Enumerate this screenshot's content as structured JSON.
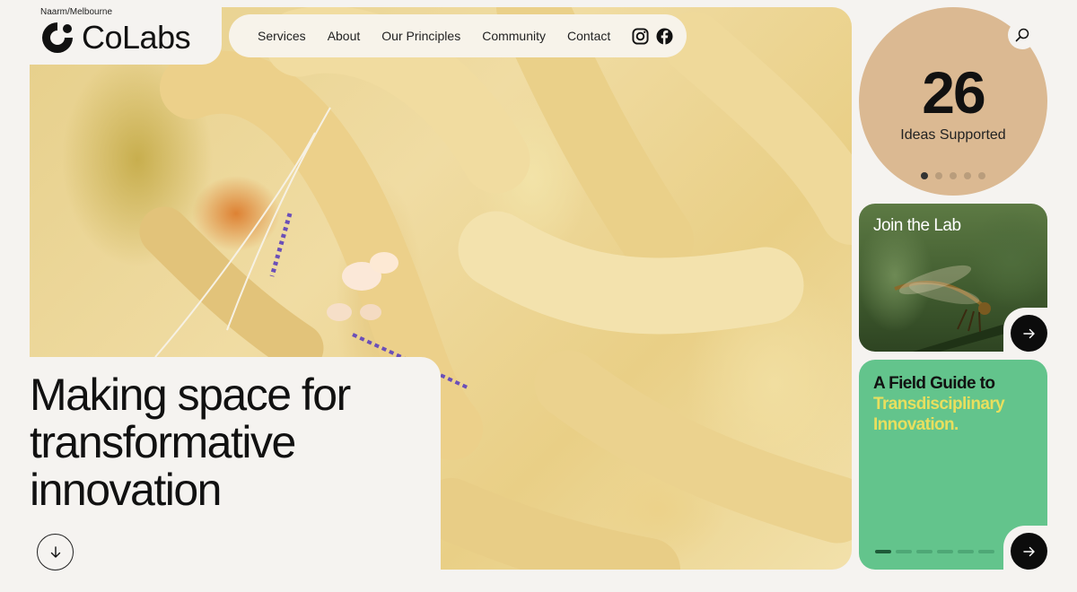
{
  "brand": {
    "region": "Naarm/Melbourne",
    "name": "CoLabs"
  },
  "nav": {
    "items": [
      "Services",
      "About",
      "Our Principles",
      "Community",
      "Contact"
    ],
    "social": [
      "instagram-icon",
      "facebook-icon"
    ]
  },
  "hero": {
    "headline": "Making space for transformative innovation",
    "image": "sea-anemone-shrimp-photo"
  },
  "stats": {
    "number": "26",
    "label": "Ideas Supported",
    "slides": 5,
    "active_slide": 1
  },
  "join": {
    "title": "Join the Lab",
    "image": "dragonfly-photo"
  },
  "guide": {
    "title_line1": "A Field Guide to",
    "title_line2": "Transdisciplinary Innovation.",
    "slides": 6,
    "active_slide": 1
  },
  "colors": {
    "background": "#f5f3f0",
    "stat_circle": "#dbb992",
    "guide_card": "#63c48c",
    "guide_accent": "#e8df5e",
    "button_dark": "#0c0c0c"
  }
}
